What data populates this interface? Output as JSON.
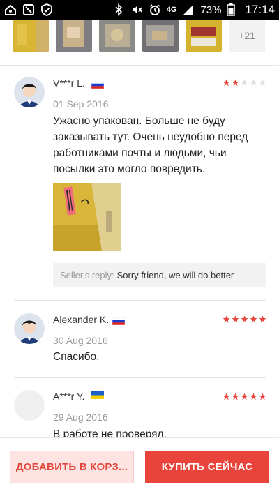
{
  "status_bar": {
    "network": "4G",
    "battery": "73%",
    "time": "17:14"
  },
  "thumbnails": {
    "more_label": "+21"
  },
  "reviews": [
    {
      "name": "V***r L.",
      "flag": "ru",
      "rating": 2,
      "date": "01 Sep 2016",
      "text": "Ужасно упакован. Больше не буду заказывать тут. Очень неудобно перед работниками почты и людьми, чьи посылки это могло повредить.",
      "seller_reply_label": "Seller's reply:",
      "seller_reply": "Sorry friend, we will do better"
    },
    {
      "name": "Alexander K.",
      "flag": "ru",
      "rating": 5,
      "date": "30 Aug 2016",
      "text": "Спасибо."
    },
    {
      "name": "A***r Y.",
      "flag": "ua",
      "rating": 5,
      "date": "29 Aug 2016",
      "text": "В работе не проверял."
    }
  ],
  "actions": {
    "add_to_cart": "ДОБАВИТЬ В КОРЗ...",
    "buy_now": "КУПИТЬ СЕЙЧАС"
  },
  "colors": {
    "accent": "#e8443c",
    "star_on": "#e8443c",
    "star_off": "#dddddd"
  }
}
